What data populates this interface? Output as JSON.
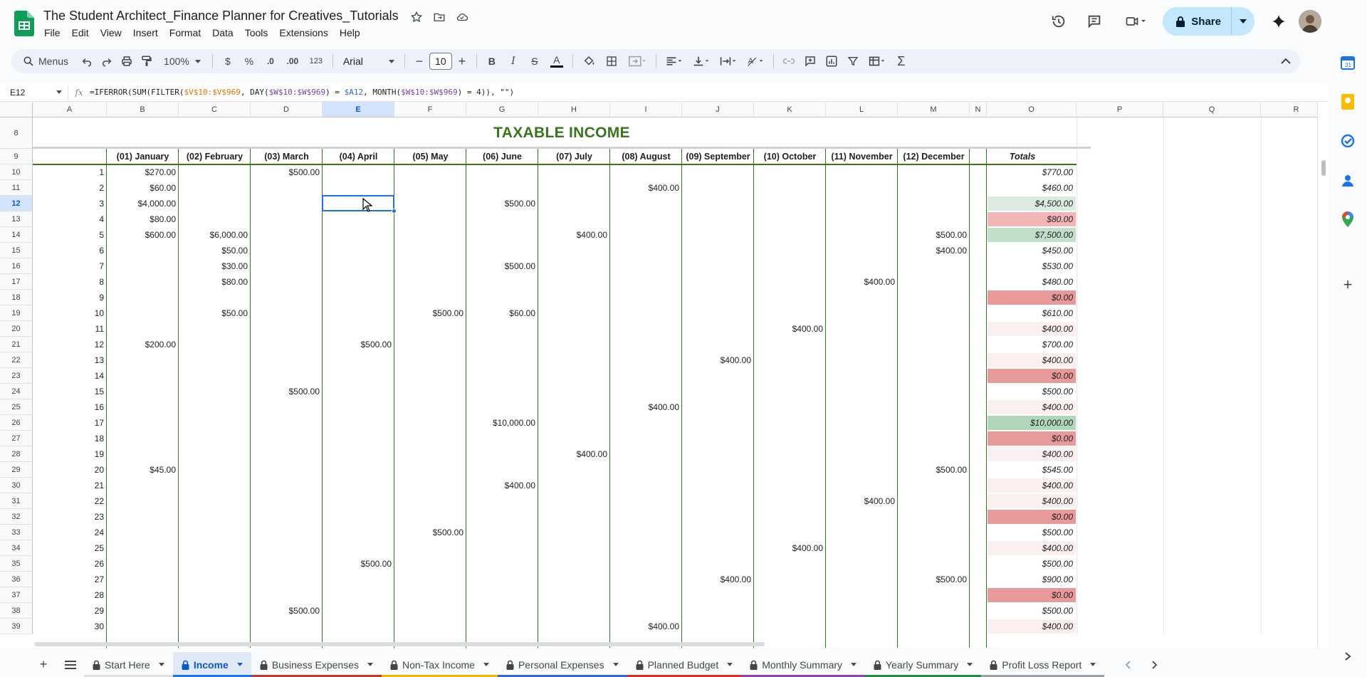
{
  "title_bar": {
    "doc_title": "The Student Architect_Finance Planner for Creatives_Tutorials",
    "menu": [
      "File",
      "Edit",
      "View",
      "Insert",
      "Format",
      "Data",
      "Tools",
      "Extensions",
      "Help"
    ],
    "share_label": "Share"
  },
  "toolbar": {
    "menus_label": "Menus",
    "zoom": "100%",
    "currency": "$",
    "percent": "%",
    "dec_decrease": ".0",
    "dec_increase": ".00",
    "number_format": "123",
    "font": "Arial",
    "font_size": "10"
  },
  "formula_bar": {
    "cell_ref": "E12",
    "formula_parts": [
      "=IFERROR(SUM(FILTER(",
      "$V$10:$V$969",
      ", DAY(",
      "$W$10:$W$969",
      ") = ",
      "$A12",
      ", MONTH(",
      "$W$10:$W$969",
      ") = 4)), \"\")"
    ]
  },
  "grid": {
    "columns": [
      "A",
      "B",
      "C",
      "D",
      "E",
      "F",
      "G",
      "H",
      "I",
      "J",
      "K",
      "L",
      "M",
      "N",
      "O",
      "P",
      "Q",
      "R"
    ],
    "selected_column": "E",
    "selected_row": "12",
    "title": "TAXABLE INCOME",
    "month_headers": [
      "(01) January",
      "(02) February",
      "(03) March",
      "(04) April",
      "(05) May",
      "(06) June",
      "(07) July",
      "(08) August",
      "(09) September",
      "(10) October",
      "(11) November",
      "(12) December"
    ],
    "totals_header": "Totals",
    "row_labels": [
      "8",
      "9",
      "10",
      "11",
      "12",
      "13",
      "14",
      "15",
      "16",
      "17",
      "18",
      "19",
      "20",
      "21",
      "22",
      "23",
      "24",
      "25",
      "26",
      "27",
      "28",
      "29",
      "30",
      "31",
      "32",
      "33",
      "34",
      "35",
      "36",
      "37",
      "38",
      "39"
    ],
    "days": [
      "1",
      "2",
      "3",
      "4",
      "5",
      "6",
      "7",
      "8",
      "9",
      "10",
      "11",
      "12",
      "13",
      "14",
      "15",
      "16",
      "17",
      "18",
      "19",
      "20",
      "21",
      "22",
      "23",
      "24",
      "25",
      "26",
      "27",
      "28",
      "29",
      "30"
    ],
    "values": [
      {
        "day": 1,
        "B": "$270.00",
        "D": "$500.00"
      },
      {
        "day": 2,
        "B": "$60.00",
        "I": "$400.00"
      },
      {
        "day": 3,
        "B": "$4,000.00",
        "G": "$500.00"
      },
      {
        "day": 4,
        "B": "$80.00"
      },
      {
        "day": 5,
        "B": "$600.00",
        "C": "$6,000.00",
        "H": "$400.00",
        "M": "$500.00"
      },
      {
        "day": 6,
        "C": "$50.00",
        "M": "$400.00"
      },
      {
        "day": 7,
        "C": "$30.00",
        "G": "$500.00"
      },
      {
        "day": 8,
        "C": "$80.00",
        "L": "$400.00"
      },
      {
        "day": 9
      },
      {
        "day": 10,
        "C": "$50.00",
        "F": "$500.00",
        "G": "$60.00"
      },
      {
        "day": 11,
        "K": "$400.00"
      },
      {
        "day": 12,
        "B": "$200.00",
        "E": "$500.00"
      },
      {
        "day": 13,
        "J": "$400.00"
      },
      {
        "day": 14
      },
      {
        "day": 15,
        "D": "$500.00"
      },
      {
        "day": 16,
        "I": "$400.00"
      },
      {
        "day": 17,
        "G": "$10,000.00"
      },
      {
        "day": 18
      },
      {
        "day": 19,
        "H": "$400.00"
      },
      {
        "day": 20,
        "B": "$45.00",
        "M": "$500.00"
      },
      {
        "day": 21,
        "G": "$400.00"
      },
      {
        "day": 22,
        "L": "$400.00"
      },
      {
        "day": 23
      },
      {
        "day": 24,
        "F": "$500.00"
      },
      {
        "day": 25,
        "K": "$400.00"
      },
      {
        "day": 26,
        "E": "$500.00"
      },
      {
        "day": 27,
        "J": "$400.00",
        "M": "$500.00"
      },
      {
        "day": 28
      },
      {
        "day": 29,
        "D": "$500.00"
      },
      {
        "day": 30,
        "I": "$400.00"
      }
    ],
    "totals": [
      "$770.00",
      "$460.00",
      "$4,500.00",
      "$80.00",
      "$7,500.00",
      "$450.00",
      "$530.00",
      "$480.00",
      "$0.00",
      "$610.00",
      "$400.00",
      "$700.00",
      "$400.00",
      "$0.00",
      "$500.00",
      "$400.00",
      "$10,000.00",
      "$0.00",
      "$400.00",
      "$545.00",
      "$400.00",
      "$400.00",
      "$0.00",
      "$500.00",
      "$400.00",
      "$500.00",
      "$900.00",
      "$0.00",
      "$500.00",
      "$400.00"
    ],
    "totals_colors": [
      "#ffffff",
      "#ffffff",
      "#dcece0",
      "#f1b5b5",
      "#c2dfc9",
      "#ffffff",
      "#ffffff",
      "#ffffff",
      "#e89a9a",
      "#ffffff",
      "#fcefef",
      "#ffffff",
      "#fcefef",
      "#e89a9a",
      "#ffffff",
      "#fcefef",
      "#b1d6ba",
      "#e89a9a",
      "#fcefef",
      "#ffffff",
      "#fcefef",
      "#fcefef",
      "#e89a9a",
      "#ffffff",
      "#fcefef",
      "#ffffff",
      "#ffffff",
      "#e89a9a",
      "#ffffff",
      "#fcefef"
    ]
  },
  "sheet_tabs": [
    {
      "label": "Start Here",
      "color": "#e0e0e0",
      "active": false
    },
    {
      "label": "Income",
      "color": "#1a73e8",
      "active": true
    },
    {
      "label": "Business Expenses",
      "color": "#c0392b",
      "active": false
    },
    {
      "label": "Non-Tax Income",
      "color": "#f4b400",
      "active": false
    },
    {
      "label": "Personal Expenses",
      "color": "#3367d6",
      "active": false
    },
    {
      "label": "Planned Budget",
      "color": "#d93025",
      "active": false
    },
    {
      "label": "Monthly Summary",
      "color": "#8e44ad",
      "active": false
    },
    {
      "label": "Yearly Summary",
      "color": "#1e8e3e",
      "active": false
    },
    {
      "label": "Profit Loss Report",
      "color": "#9aa0a6",
      "active": false
    }
  ],
  "colors": {
    "accent_green": "#38761d",
    "selection_blue": "#1a73e8",
    "share_bg": "#c2e7ff"
  }
}
